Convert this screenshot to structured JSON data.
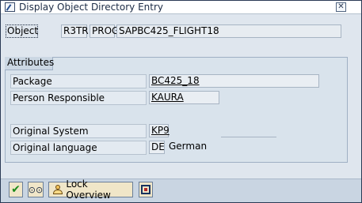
{
  "window": {
    "title": "Display Object Directory Entry",
    "close_glyph": "✕",
    "title_icon": "edit-document-icon"
  },
  "object": {
    "label": "Object",
    "program_id": "R3TR",
    "object_type": "PROG",
    "object_name": "SAPBC425_FLIGHT18"
  },
  "attributes": {
    "group_title": "Attributes",
    "package_label": "Package",
    "package_value": "BC425_18",
    "person_label": "Person Responsible",
    "person_value": "KAURA",
    "orig_system_label": "Original System",
    "orig_system_value": "KP9",
    "orig_system_extra": "",
    "orig_language_label": "Original language",
    "orig_language_value": "DE",
    "orig_language_text": "German"
  },
  "toolbar": {
    "confirm_icon": "checkmark-icon",
    "display_icon": "glasses-icon",
    "lock_overview_label": "Lock Overview",
    "lock_icon": "lock-overview-icon",
    "cancel_icon": "cancel-icon"
  },
  "colors": {
    "window_bg": "#dfe6ee",
    "group_bg": "#d9e3ec",
    "button_bg": "#f0e6c8",
    "check_green": "#1a8a1a"
  }
}
